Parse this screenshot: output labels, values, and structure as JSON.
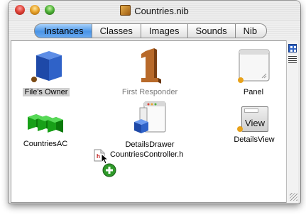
{
  "window": {
    "title": "Countries.nib"
  },
  "toolbar": {
    "tabs": [
      {
        "label": "Instances",
        "active": true
      },
      {
        "label": "Classes",
        "active": false
      },
      {
        "label": "Images",
        "active": false
      },
      {
        "label": "Sounds",
        "active": false
      },
      {
        "label": "Nib",
        "active": false
      }
    ]
  },
  "instances": [
    {
      "label": "File's Owner",
      "icon": "cube-icon"
    },
    {
      "label": "First Responder",
      "icon": "number-one-icon"
    },
    {
      "label": "Panel",
      "icon": "panel-window-icon"
    },
    {
      "label": "CountriesAC",
      "icon": "array-controller-icon"
    },
    {
      "label": "DetailsDrawer",
      "icon": "drawer-icon"
    },
    {
      "label": "DetailsView",
      "icon": "view-icon"
    }
  ],
  "detailsview_icon_text": "View",
  "drag": {
    "filename": "CountriesController.h",
    "file_badge": "h",
    "cursor": "plus-cursor-icon"
  },
  "colors": {
    "tab_active": "#4a94e6",
    "badge": "#e8a21a",
    "add_badge": "#2f9a2a"
  }
}
